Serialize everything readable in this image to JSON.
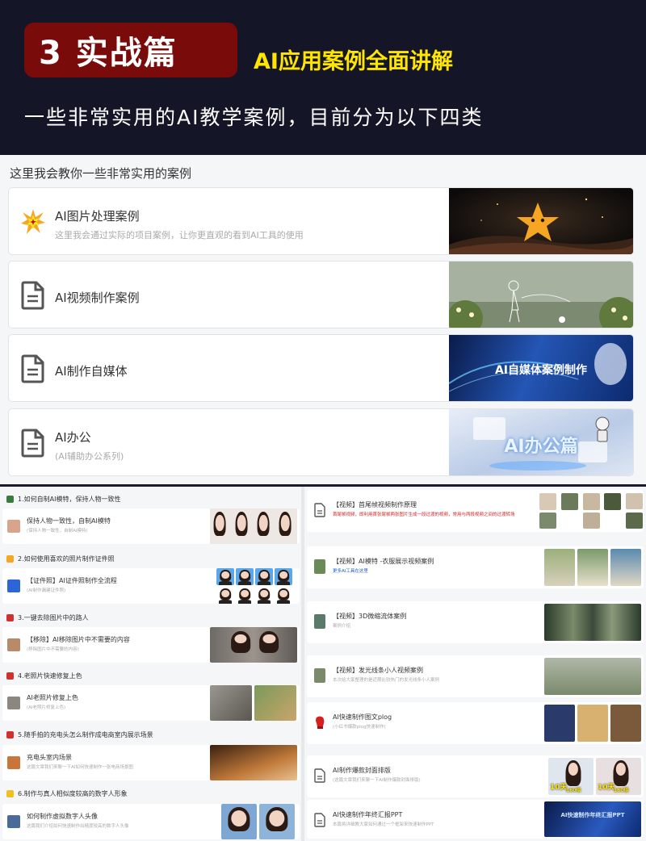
{
  "header": {
    "badge": "3 实战篇",
    "subtitle": "AI应用案例全面讲解",
    "line": "一些非常实用的AI教学案例，目前分为以下四类",
    "colors": {
      "background": "#151528",
      "badge": "#7a0b0b",
      "subtitle": "#ffe600"
    }
  },
  "intro": "这里我会教你一些非常实用的案例",
  "categories": [
    {
      "title": "AI图片处理案例",
      "desc": "这里我会通过实际的项目案例，让你更直观的看到AI工具的使用",
      "icon": "explosion-icon",
      "thumb_text": ""
    },
    {
      "title": "AI视频制作案例",
      "desc": "",
      "icon": "document-icon",
      "thumb_text": ""
    },
    {
      "title": "AI制作自媒体",
      "desc": "",
      "icon": "document-icon",
      "thumb_text": "AI自媒体案例制作"
    },
    {
      "title": "AI办公",
      "desc": "(AI辅助办公系列)",
      "icon": "document-icon",
      "thumb_text": "AI办公篇"
    }
  ],
  "left_sections": [
    {
      "title": "1.如何自制AI模特，保持人物一致性",
      "card_title": "保持人物一致性，自制AI模特",
      "card_desc": "(保持人物一致性，自制AI模特)"
    },
    {
      "title": "2.如何使用喜欢的照片制作证件照",
      "card_title": "【证件照】AI证件照制作全流程",
      "card_desc": "(AI制作漏建证件照)"
    },
    {
      "title": "3.一键去除图片中的路人",
      "card_title": "【移除】AI移除图片中不需要的内容",
      "card_desc": "(移除图片中不需要的内容)"
    },
    {
      "title": "4.老照片快速修复上色",
      "card_title": "AI老照片修复上色",
      "card_desc": "(AI老照片修复上色)"
    },
    {
      "title": "5.随手拍的充电头怎么制作成电商室内展示场景",
      "card_title": "充电头室内场景",
      "card_desc": "这篇文章我们来聊一下AI如何快速制作一张电商场景图"
    },
    {
      "title": "6.制作与真人相似度较高的数字人形象",
      "card_title": "如何制作虚拟数字人头像",
      "card_desc": "这篇我们介绍如何快速制作出精度较高的数字人头像"
    }
  ],
  "right_cards": [
    {
      "title": "【视频】首尾帧视频制作原理",
      "desc": "首尾帧视频，即利用首张尾帧两张图片生成一段过渡的视频，常用与两段视频之间的过渡转场",
      "desc_style": "red",
      "icon": "document-icon"
    },
    {
      "title": "【视频】AI模特 -衣服展示视频案例",
      "desc": "更多AI工具在这里",
      "desc_style": "blue",
      "icon": "image-icon"
    },
    {
      "title": "【视频】3D微缩流体案例",
      "desc": "案例介绍",
      "desc_style": "gray",
      "icon": "image-icon"
    },
    {
      "title": "【视频】发光线条小人视频案例",
      "desc": "本次给大家整理的是近期比较热门的发光线条小人案例",
      "desc_style": "gray",
      "icon": "image-icon"
    },
    {
      "title": "AI快速制作图文plog",
      "desc": "(小红书爆款plog快速制作)",
      "desc_style": "gray",
      "icon": "boxing-glove-icon"
    },
    {
      "title": "AI制作爆款封面排版",
      "desc": "(这篇文章我们来聊一下AI制作爆款封面排版)",
      "desc_style": "gray",
      "icon": "document-icon"
    },
    {
      "title": "AI快速制作年终汇报PPT",
      "desc": "本篇将详细教大家如何通过一个框架来快速制作PPT",
      "desc_style": "gray",
      "icon": "document-icon"
    }
  ],
  "thumb_labels": {
    "cover_a": "10天",
    "cover_a_sub": "160倍",
    "cover_b": "10天",
    "cover_b_sub": "160倍",
    "ppt": "AI快速制作年终汇报PPT"
  }
}
